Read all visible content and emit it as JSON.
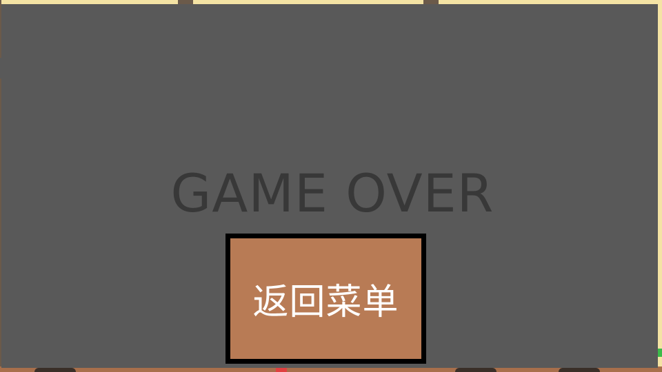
{
  "game_over": {
    "title": "GAME OVER",
    "return_button_label": "返回菜单"
  },
  "colors": {
    "overlay": "#595959",
    "title_text": "#383838",
    "button_fill": "#b87b55",
    "button_border": "#000000",
    "button_text": "#ffffff",
    "board_background": "#a86f4b",
    "board_tile": "#f4e3a4"
  }
}
